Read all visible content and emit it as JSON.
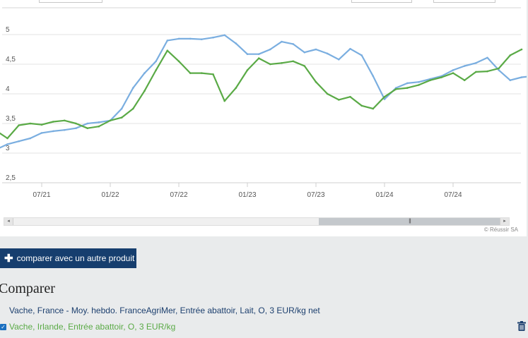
{
  "chart_data": {
    "type": "line",
    "ylim": [
      2.5,
      5.0
    ],
    "y_ticks": [
      "2,5",
      "3",
      "3,5",
      "4",
      "4,5",
      "5"
    ],
    "x_ticks": [
      "07/21",
      "01/22",
      "07/22",
      "01/23",
      "07/23",
      "01/24",
      "07/24"
    ],
    "grid": "horizontal",
    "series": [
      {
        "name": "Vache, France - Moy. hebdo. FranceAgriMer, Entrée abattoir, Lait, O, 3 EUR/kg net",
        "color": "#7aaee0",
        "points": [
          [
            "2021-01",
            3.01
          ],
          [
            "2021-02",
            3.03
          ],
          [
            "2021-03",
            3.06
          ],
          [
            "2021-04",
            3.15
          ],
          [
            "2021-05",
            3.2
          ],
          [
            "2021-06",
            3.25
          ],
          [
            "2021-07",
            3.34
          ],
          [
            "2021-08",
            3.37
          ],
          [
            "2021-09",
            3.39
          ],
          [
            "2021-10",
            3.42
          ],
          [
            "2021-11",
            3.5
          ],
          [
            "2021-12",
            3.52
          ],
          [
            "2022-01",
            3.55
          ],
          [
            "2022-02",
            3.75
          ],
          [
            "2022-03",
            4.1
          ],
          [
            "2022-04",
            4.35
          ],
          [
            "2022-05",
            4.55
          ],
          [
            "2022-06",
            4.9
          ],
          [
            "2022-07",
            4.93
          ],
          [
            "2022-08",
            4.93
          ],
          [
            "2022-09",
            4.92
          ],
          [
            "2022-10",
            4.95
          ],
          [
            "2022-11",
            4.99
          ],
          [
            "2022-12",
            4.85
          ],
          [
            "2023-01",
            4.67
          ],
          [
            "2023-02",
            4.67
          ],
          [
            "2023-03",
            4.75
          ],
          [
            "2023-04",
            4.88
          ],
          [
            "2023-05",
            4.84
          ],
          [
            "2023-06",
            4.7
          ],
          [
            "2023-07",
            4.75
          ],
          [
            "2023-08",
            4.68
          ],
          [
            "2023-09",
            4.58
          ],
          [
            "2023-10",
            4.76
          ],
          [
            "2023-11",
            4.65
          ],
          [
            "2023-12",
            4.3
          ],
          [
            "2024-01",
            3.91
          ],
          [
            "2024-02",
            4.1
          ],
          [
            "2024-03",
            4.18
          ],
          [
            "2024-04",
            4.2
          ],
          [
            "2024-05",
            4.25
          ],
          [
            "2024-06",
            4.3
          ],
          [
            "2024-07",
            4.4
          ],
          [
            "2024-08",
            4.47
          ],
          [
            "2024-09",
            4.52
          ],
          [
            "2024-10",
            4.61
          ],
          [
            "2024-11",
            4.4
          ],
          [
            "2024-12",
            4.23
          ],
          [
            "2025-01",
            4.28
          ],
          [
            "2025-02",
            4.3
          ]
        ]
      },
      {
        "name": "Vache, Irlande, Entrée abattoir, O, 3 EUR/kg",
        "color": "#5aaa46",
        "points": [
          [
            "2021-01",
            3.1
          ],
          [
            "2021-02",
            3.3
          ],
          [
            "2021-03",
            3.38
          ],
          [
            "2021-04",
            3.25
          ],
          [
            "2021-05",
            3.47
          ],
          [
            "2021-06",
            3.5
          ],
          [
            "2021-07",
            3.48
          ],
          [
            "2021-08",
            3.53
          ],
          [
            "2021-09",
            3.55
          ],
          [
            "2021-10",
            3.5
          ],
          [
            "2021-11",
            3.42
          ],
          [
            "2021-12",
            3.45
          ],
          [
            "2022-01",
            3.55
          ],
          [
            "2022-02",
            3.6
          ],
          [
            "2022-03",
            3.75
          ],
          [
            "2022-04",
            4.05
          ],
          [
            "2022-05",
            4.4
          ],
          [
            "2022-06",
            4.73
          ],
          [
            "2022-07",
            4.55
          ],
          [
            "2022-08",
            4.35
          ],
          [
            "2022-09",
            4.35
          ],
          [
            "2022-10",
            4.33
          ],
          [
            "2022-11",
            3.88
          ],
          [
            "2022-12",
            4.1
          ],
          [
            "2023-01",
            4.4
          ],
          [
            "2023-02",
            4.6
          ],
          [
            "2023-03",
            4.5
          ],
          [
            "2023-04",
            4.52
          ],
          [
            "2023-05",
            4.55
          ],
          [
            "2023-06",
            4.47
          ],
          [
            "2023-07",
            4.2
          ],
          [
            "2023-08",
            4.0
          ],
          [
            "2023-09",
            3.9
          ],
          [
            "2023-10",
            3.95
          ],
          [
            "2023-11",
            3.8
          ],
          [
            "2023-12",
            3.75
          ],
          [
            "2024-01",
            3.95
          ],
          [
            "2024-02",
            4.08
          ],
          [
            "2024-03",
            4.1
          ],
          [
            "2024-04",
            4.15
          ],
          [
            "2024-05",
            4.23
          ],
          [
            "2024-06",
            4.28
          ],
          [
            "2024-07",
            4.35
          ],
          [
            "2024-08",
            4.23
          ],
          [
            "2024-09",
            4.37
          ],
          [
            "2024-10",
            4.38
          ],
          [
            "2024-11",
            4.43
          ],
          [
            "2024-12",
            4.65
          ],
          [
            "2025-01",
            4.75
          ]
        ]
      }
    ]
  },
  "scrollbar": {
    "thumb_glyph": "|||",
    "left_arrow": "◂",
    "right_arrow": "▸"
  },
  "credit": "© Réussir SA",
  "compare_button": {
    "icon": "plus-icon",
    "label": "comparer avec un autre produit"
  },
  "compare": {
    "heading": "Comparer",
    "items": [
      {
        "label": "Vache, France - Moy. hebdo. FranceAgriMer, Entrée abattoir, Lait, O, 3 EUR/kg net",
        "color": "#1c3f6e"
      },
      {
        "label": "Vache, Irlande, Entrée abattoir, O, 3 EUR/kg",
        "color": "#5aaa46",
        "checked": true
      }
    ],
    "delete_icon": "trash-icon"
  }
}
